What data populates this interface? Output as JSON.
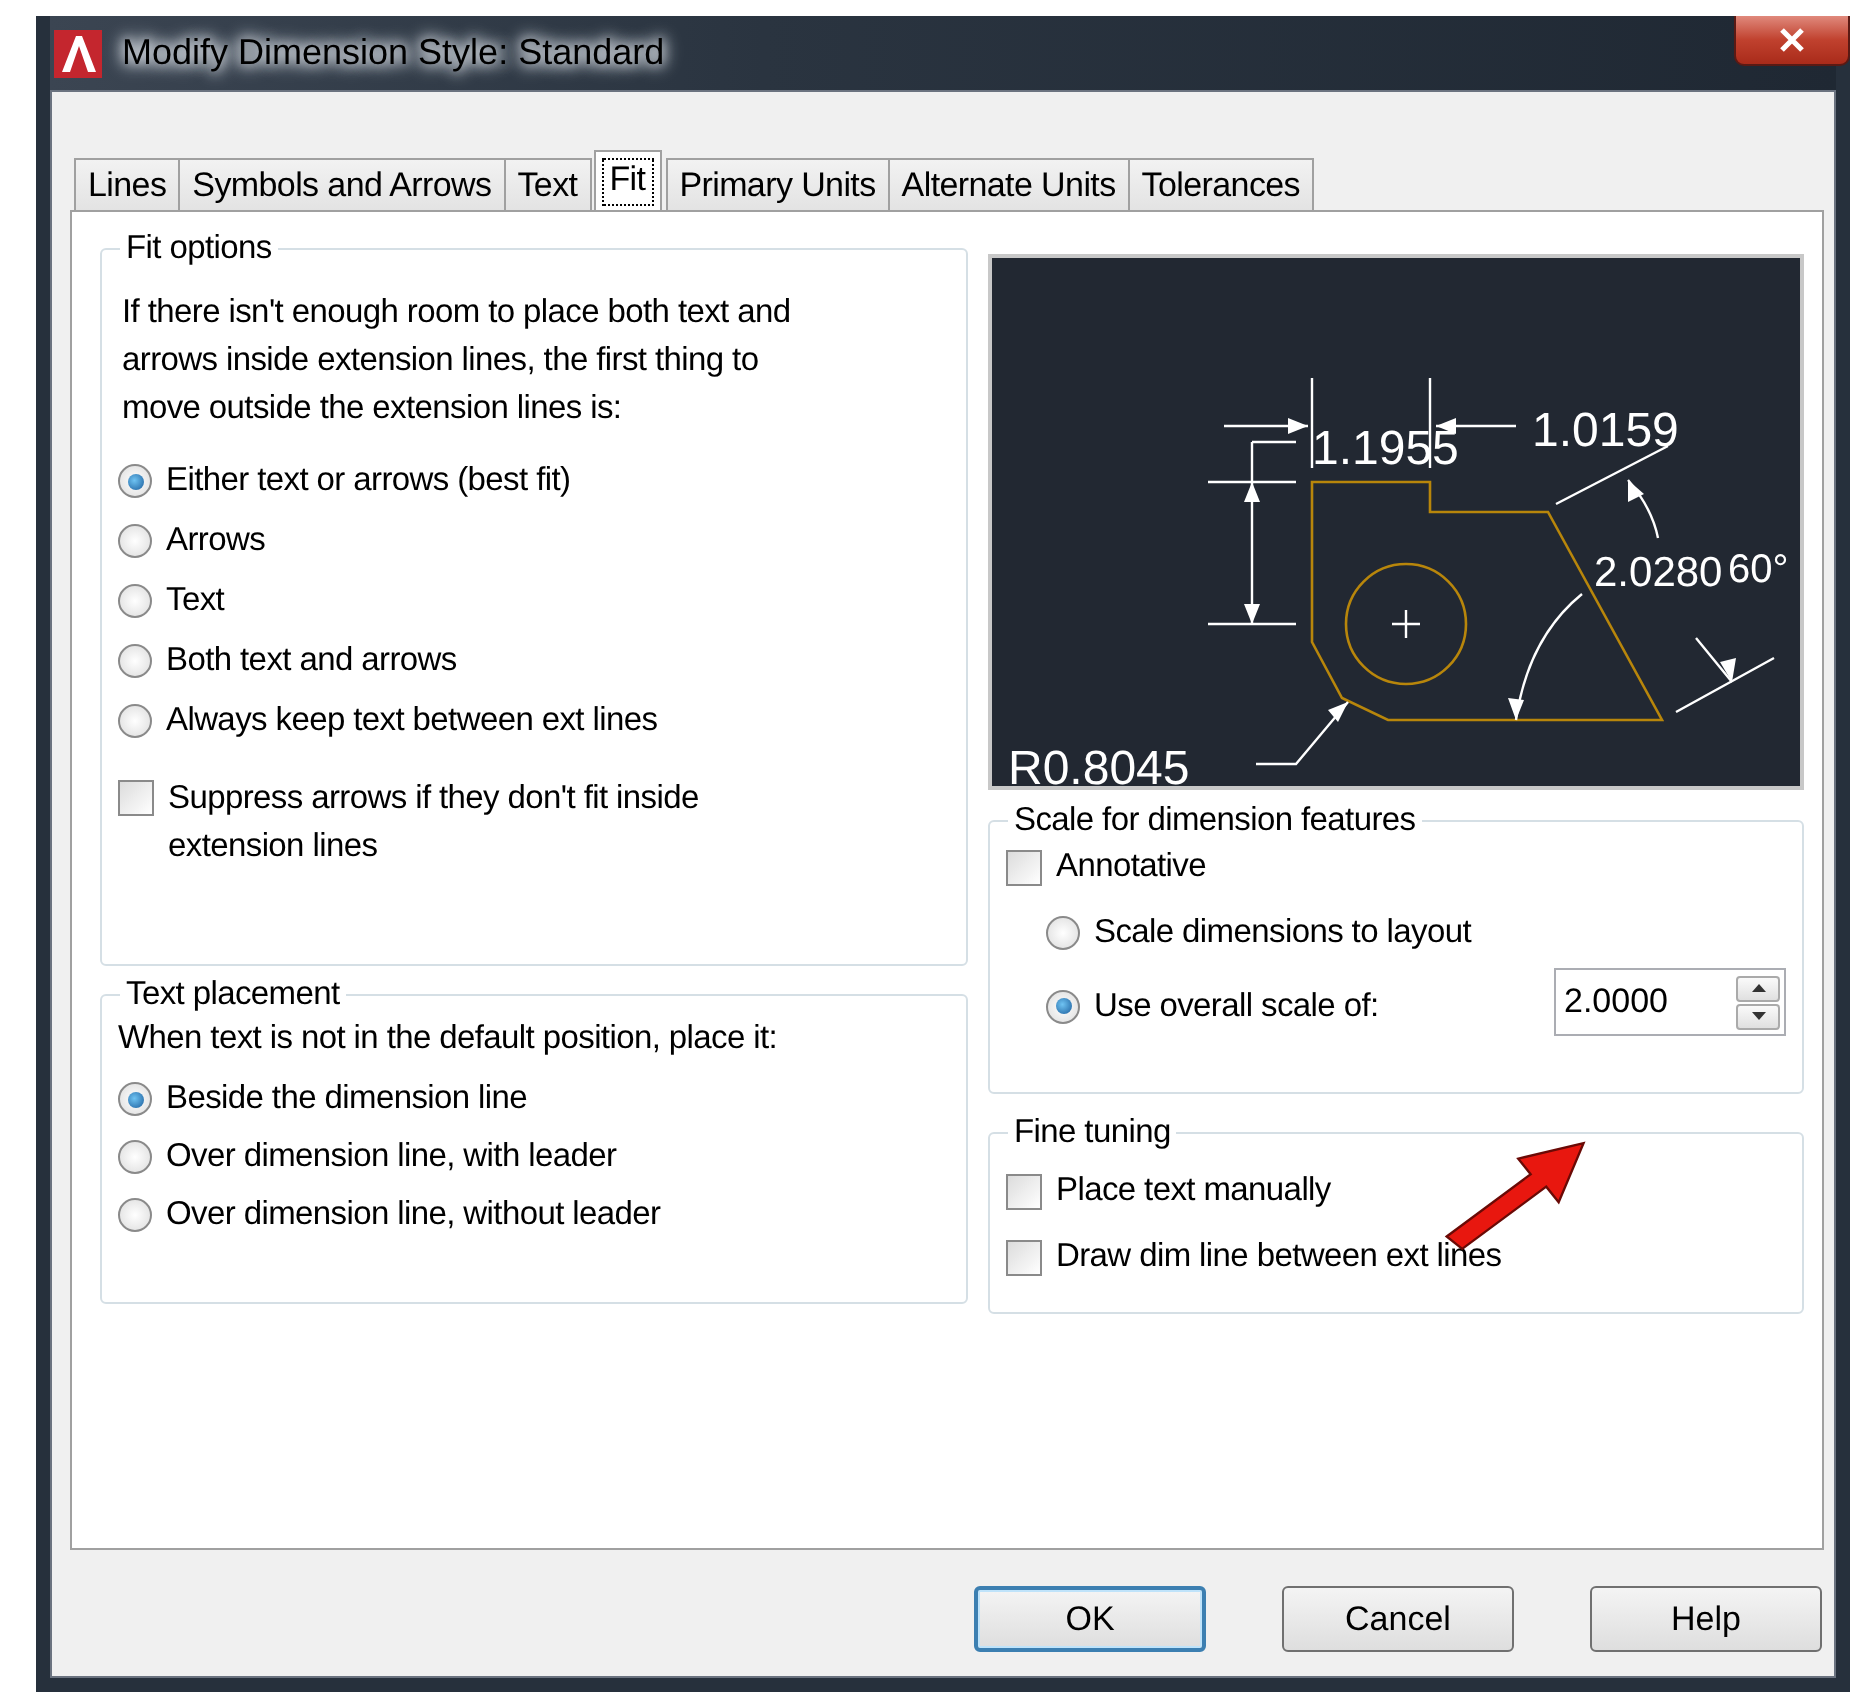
{
  "window": {
    "title": "Modify Dimension Style: Standard"
  },
  "tabs": [
    {
      "label": "Lines",
      "selected": false
    },
    {
      "label": "Symbols and Arrows",
      "selected": false
    },
    {
      "label": "Text",
      "selected": false
    },
    {
      "label": "Fit",
      "selected": true
    },
    {
      "label": "Primary Units",
      "selected": false
    },
    {
      "label": "Alternate Units",
      "selected": false
    },
    {
      "label": "Tolerances",
      "selected": false
    }
  ],
  "fit_options": {
    "title": "Fit options",
    "description": "If there isn't enough room to place both text and arrows inside extension lines, the first thing to move outside the extension lines is:",
    "options": [
      {
        "label": "Either text or arrows (best fit)",
        "selected": true
      },
      {
        "label": "Arrows",
        "selected": false
      },
      {
        "label": "Text",
        "selected": false
      },
      {
        "label": "Both text and arrows",
        "selected": false
      },
      {
        "label": "Always keep text between ext lines",
        "selected": false
      }
    ],
    "suppress_arrows": {
      "label": "Suppress arrows if they don't fit inside extension lines",
      "checked": false
    }
  },
  "text_placement": {
    "title": "Text placement",
    "description": "When text is not in the default position, place it:",
    "options": [
      {
        "label": "Beside the dimension line",
        "selected": true
      },
      {
        "label": "Over dimension line, with leader",
        "selected": false
      },
      {
        "label": "Over dimension line, without leader",
        "selected": false
      }
    ]
  },
  "preview": {
    "labels": [
      "1.1955",
      "1.0159",
      "2.0280",
      "60°",
      "R0.8045"
    ]
  },
  "scale": {
    "title": "Scale for dimension features",
    "annotative": {
      "label": "Annotative",
      "checked": false
    },
    "options": [
      {
        "label": "Scale dimensions to layout",
        "selected": false
      },
      {
        "label": "Use overall scale of:",
        "selected": true
      }
    ],
    "value": "2.0000"
  },
  "fine_tuning": {
    "title": "Fine tuning",
    "options": [
      {
        "label": "Place text manually",
        "checked": false
      },
      {
        "label": "Draw dim line between ext lines",
        "checked": false
      }
    ]
  },
  "buttons": [
    {
      "label": "OK",
      "default": true
    },
    {
      "label": "Cancel",
      "default": false
    },
    {
      "label": "Help",
      "default": false
    }
  ]
}
